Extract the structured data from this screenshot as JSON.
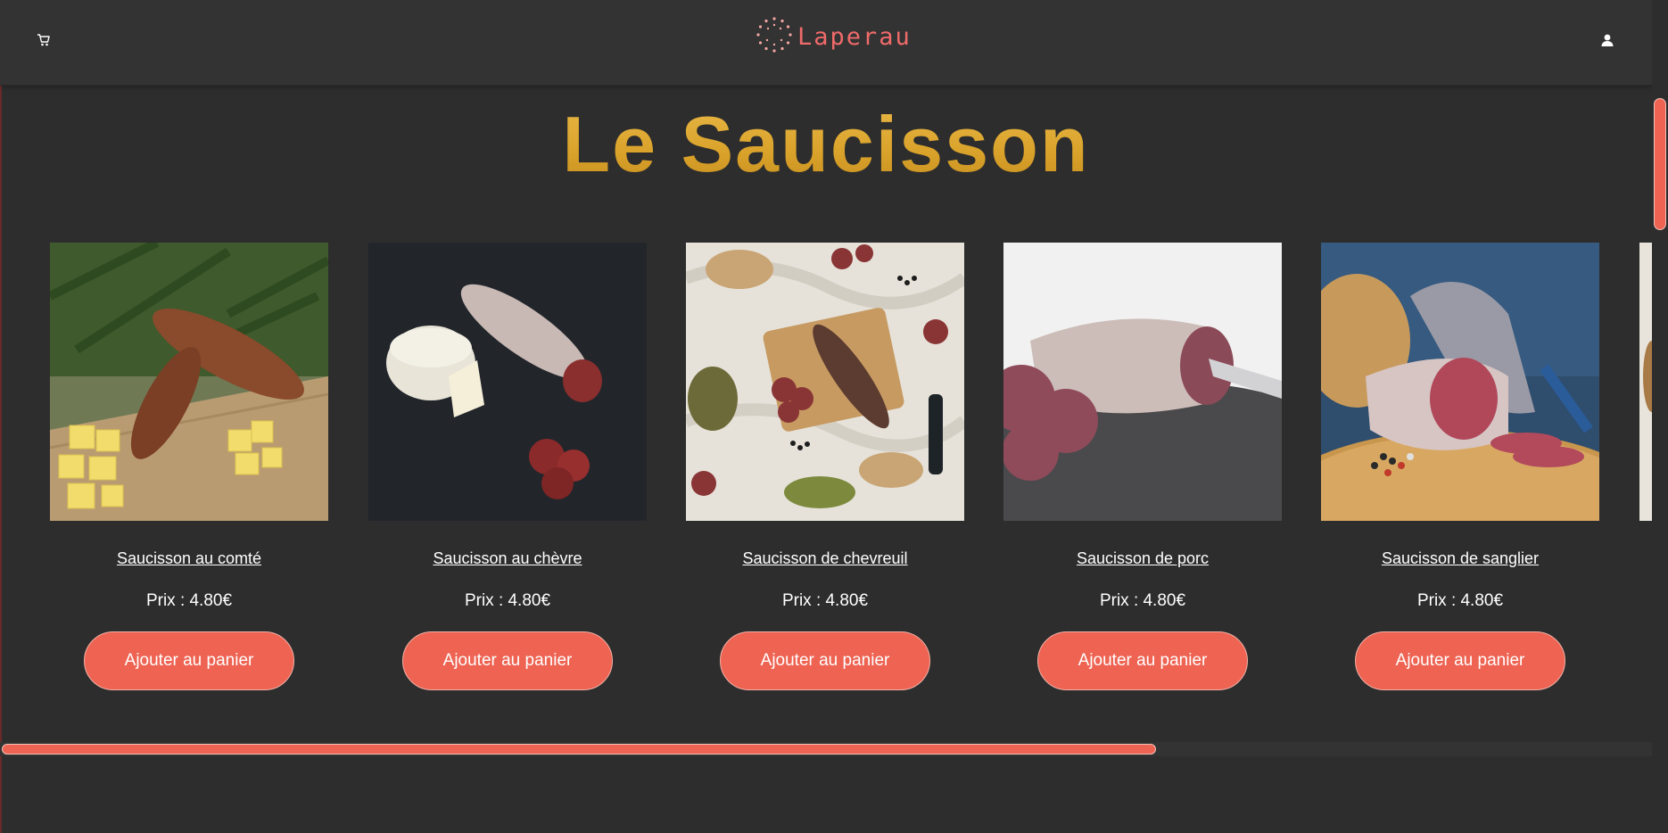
{
  "header": {
    "brand": "Laperau",
    "cart_icon": "cart-icon",
    "user_icon": "user-icon",
    "brand_color": "#f06a6a"
  },
  "page": {
    "title": "Le Saucisson"
  },
  "products": [
    {
      "name": "Saucisson au comté",
      "price": "Prix : 4.80€",
      "button": "Ajouter au panier"
    },
    {
      "name": "Saucisson au chèvre",
      "price": "Prix : 4.80€",
      "button": "Ajouter au panier"
    },
    {
      "name": "Saucisson de chevreuil",
      "price": "Prix : 4.80€",
      "button": "Ajouter au panier"
    },
    {
      "name": "Saucisson de porc",
      "price": "Prix : 4.80€",
      "button": "Ajouter au panier"
    },
    {
      "name": "Saucisson de sanglier",
      "price": "Prix : 4.80€",
      "button": "Ajouter au panier"
    }
  ],
  "scroll": {
    "horizontal_visible_fraction": 0.7,
    "vertical_position_fraction": 0.0
  },
  "colors": {
    "background": "#2d2d2d",
    "accent": "#ee6352",
    "title_gold": "#d9a22a"
  }
}
